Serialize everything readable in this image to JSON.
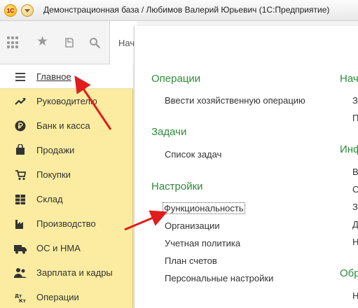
{
  "window": {
    "logo_text": "1С",
    "title": "Демонстрационная база / Любимов Валерий Юрьевич  (1С:Предприятие)"
  },
  "toolbar": {
    "start_tab": "Нач"
  },
  "sidebar": {
    "items": [
      {
        "label": "Главное",
        "icon": "hamburger-icon"
      },
      {
        "label": "Руководителю",
        "icon": "trend-icon"
      },
      {
        "label": "Банк и касса",
        "icon": "ruble-icon"
      },
      {
        "label": "Продажи",
        "icon": "bag-icon"
      },
      {
        "label": "Покупки",
        "icon": "cart-icon"
      },
      {
        "label": "Склад",
        "icon": "warehouse-icon"
      },
      {
        "label": "Производство",
        "icon": "factory-icon"
      },
      {
        "label": "ОС и НМА",
        "icon": "truck-icon"
      },
      {
        "label": "Зарплата и кадры",
        "icon": "people-icon"
      },
      {
        "label": "Операции",
        "icon": "operations-icon"
      }
    ]
  },
  "panel": {
    "col1": {
      "operations_title": "Операции",
      "operations_items": [
        "Ввести хозяйственную операцию"
      ],
      "tasks_title": "Задачи",
      "tasks_items": [
        "Список задач"
      ],
      "settings_title": "Настройки",
      "settings_items": [
        "Функциональность",
        "Организации",
        "Учетная политика",
        "План счетов",
        "Персональные настройки"
      ]
    },
    "col2": {
      "titles": [
        "Нач",
        "Инф",
        "Обр"
      ],
      "items": [
        "З",
        "П",
        "В",
        "С",
        "З",
        "Д",
        "Н",
        "Н"
      ]
    }
  },
  "colors": {
    "sidebar_bg": "#fbeca1",
    "section_title": "#2e8b3a",
    "arrow": "#e01c1c"
  }
}
